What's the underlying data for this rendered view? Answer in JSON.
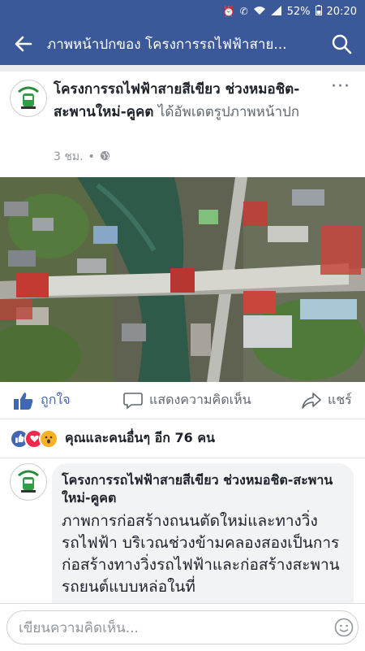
{
  "status_bar": {
    "battery_pct": "52%",
    "time": "20:20",
    "icons": [
      "alarm-icon",
      "call-icon",
      "wifi-icon",
      "signal-icon",
      "battery-icon"
    ]
  },
  "header": {
    "title": "ภาพหน้าปกของ โครงการรถไฟฟ้าสาย...",
    "back_icon": "back-arrow-icon",
    "search_icon": "search-icon"
  },
  "post": {
    "page_name": "โครงการรถไฟฟ้าสายสีเขียว ช่วงหมอชิต-สะพานใหม่-คูคต",
    "action": "ได้อัพเดตรูปภาพหน้าปก",
    "time": "3 ชม.",
    "separator": "•",
    "privacy_icon": "globe-icon",
    "more_icon": "more-icon",
    "photo_name": "aerial-construction-photo"
  },
  "actions": {
    "like": "ถูกใจ",
    "comment": "แสดงความคิดเห็น",
    "share": "แชร์"
  },
  "reactions": {
    "summary": "คุณและคนอื่นๆ อีก 76 คน",
    "types": [
      "like",
      "love",
      "wow"
    ],
    "colors": {
      "like": "#4267b2",
      "love": "#f0284a",
      "wow": "#f7b125"
    }
  },
  "comment": {
    "author": "โครงการรถไฟฟ้าสายสีเขียว ช่วงหมอชิต-สะพานใหม่-คูคต",
    "text": "ภาพการก่อสร้างถนนตัดใหม่และทางวิ่งรถไฟฟ้า บริเวณช่วงข้ามคลองสองเป็นการก่อสร้างทางวิ่งรถไฟฟ้าและก่อสร้างสะพานรถยนต์แบบหล่อในที่"
  },
  "composer": {
    "placeholder": "เขียนความคิดเห็น..."
  },
  "colors": {
    "brand": "#3b5998",
    "text": "#1d2129",
    "muted": "#606770",
    "bubble": "#f2f3f5"
  }
}
